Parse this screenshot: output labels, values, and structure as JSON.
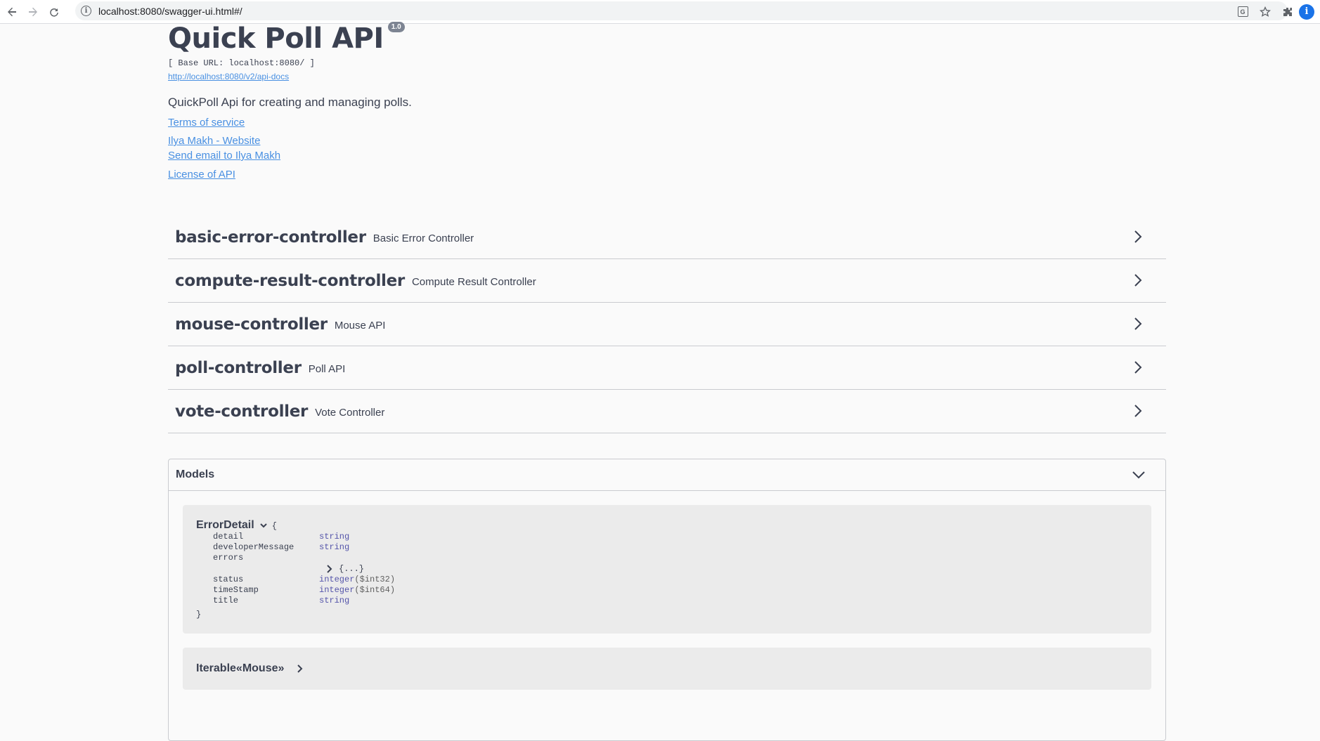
{
  "browser": {
    "url": "localhost:8080/swagger-ui.html#/",
    "profile_initial": "i",
    "icons": [
      "back-arrow-icon",
      "forward-arrow-icon",
      "reload-icon",
      "info-icon",
      "translate-icon",
      "star-icon",
      "extensions-icon",
      "profile-icon"
    ]
  },
  "info": {
    "title": "Quick Poll API",
    "version": "1.0",
    "base_url": "[ Base URL: localhost:8080/ ]",
    "docs_link": "http://localhost:8080/v2/api-docs",
    "description": "QuickPoll Api for creating and managing polls.",
    "terms": "Terms of service",
    "contact_website": "Ilya Makh - Website",
    "contact_email": "Send email to Ilya Makh",
    "license": "License of API"
  },
  "tags": [
    {
      "name": "basic-error-controller",
      "description": "Basic Error Controller"
    },
    {
      "name": "compute-result-controller",
      "description": "Compute Result Controller"
    },
    {
      "name": "mouse-controller",
      "description": "Mouse API"
    },
    {
      "name": "poll-controller",
      "description": "Poll API"
    },
    {
      "name": "vote-controller",
      "description": "Vote Controller"
    }
  ],
  "models": {
    "title": "Models",
    "error_detail": {
      "name": "ErrorDetail",
      "open_brace": "{",
      "close_brace": "}",
      "props": [
        {
          "name": "detail",
          "type": "string",
          "format": ""
        },
        {
          "name": "developerMessage",
          "type": "string",
          "format": ""
        },
        {
          "name": "errors",
          "type": "",
          "format": ""
        },
        {
          "name": "status",
          "type": "integer",
          "format": "($int32)"
        },
        {
          "name": "timeStamp",
          "type": "integer",
          "format": "($int64)"
        },
        {
          "name": "title",
          "type": "string",
          "format": ""
        }
      ],
      "errors_collapsed": "{...}"
    },
    "iterable_mouse": {
      "name": "Iterable«Mouse»"
    }
  },
  "colors": {
    "link": "#4990e2",
    "text": "#3b4151",
    "type": "#5555aa",
    "version_badge": "#7d8492",
    "profile": "#1a73e8"
  }
}
